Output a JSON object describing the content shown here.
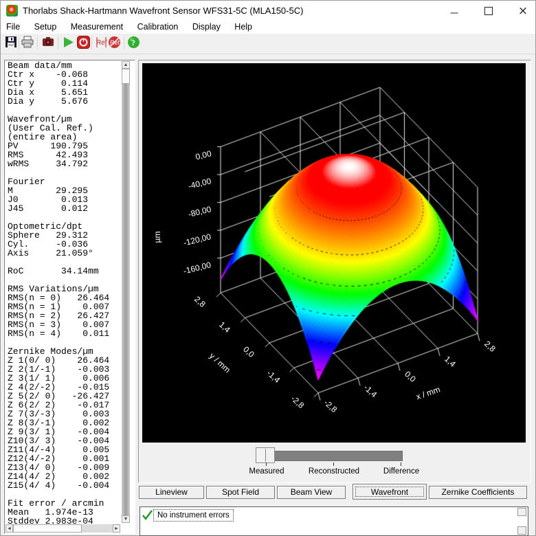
{
  "window": {
    "title": "Thorlabs Shack-Hartmann Wavefront Sensor WFS31-5C (MLA150-5C)",
    "controls": [
      "minimize",
      "maximize",
      "close"
    ]
  },
  "menu": {
    "items": [
      "File",
      "Setup",
      "Measurement",
      "Calibration",
      "Display",
      "Help"
    ]
  },
  "toolbar": {
    "icons": [
      "save",
      "print",
      "camera",
      "start",
      "stop",
      "reference-flat",
      "reference-user",
      "help"
    ]
  },
  "left_panel": {
    "lines": [
      "Beam data/mm",
      "Ctr x    -0.068",
      "Ctr y     0.114",
      "Dia x     5.651",
      "Dia y     5.676",
      "",
      "Wavefront/µm",
      "(User Cal. Ref.)",
      "(entire area)",
      "PV      190.795",
      "RMS      42.493",
      "wRMS     34.792",
      "",
      "Fourier",
      "M        29.295",
      "J0        0.013",
      "J45       0.012",
      "",
      "Optometric/dpt",
      "Sphere   29.312",
      "Cyl.     -0.036",
      "Axis     21.059°",
      "",
      "RoC       34.14mm",
      "",
      "RMS Variations/µm",
      "RMS(n = 0)   26.464",
      "RMS(n = 1)    0.007",
      "RMS(n = 2)   26.427",
      "RMS(n = 3)    0.007",
      "RMS(n = 4)    0.011",
      "",
      "Zernike Modes/µm",
      "Z 1(0/ 0)    26.464",
      "Z 2(1/-1)    -0.003",
      "Z 3(1/ 1)     0.006",
      "Z 4(2/-2)    -0.015",
      "Z 5(2/ 0)   -26.427",
      "Z 6(2/ 2)    -0.017",
      "Z 7(3/-3)     0.003",
      "Z 8(3/-1)     0.002",
      "Z 9(3/ 1)    -0.004",
      "Z10(3/ 3)    -0.004",
      "Z11(4/-4)     0.005",
      "Z12(4/-2)     0.001",
      "Z13(4/ 0)    -0.009",
      "Z14(4/ 2)     0.002",
      "Z15(4/ 4)    -0.004",
      "",
      "Fit error / arcmin",
      "Mean   1.974e-13",
      "Stddev 2.983e-04"
    ]
  },
  "slider": {
    "labels": [
      "Measured",
      "Reconstructed",
      "Difference"
    ],
    "value": "Measured"
  },
  "tabs": {
    "items": [
      "Lineview",
      "Spot Field",
      "Beam View",
      "Wavefront",
      "Zernike Coefficients"
    ],
    "active": "Wavefront"
  },
  "status": {
    "message": "No instrument errors",
    "state": "ok",
    "ok_color": "#1f9e1f"
  },
  "chart_data": {
    "type": "surface3d",
    "title": "Wavefront",
    "x": {
      "label": "x / mm",
      "range": [
        -2.8,
        2.8
      ],
      "ticks": [
        -2.8,
        -1.4,
        0,
        1.4,
        2.8
      ],
      "tick_labels": [
        "-2,8",
        "-1,4",
        "0,0",
        "1,4",
        "2,8"
      ]
    },
    "y": {
      "label": "y / mm",
      "range": [
        -2.8,
        2.8
      ],
      "ticks": [
        -2.8,
        -1.4,
        0,
        1.4,
        2.8
      ],
      "tick_labels": [
        "2,8",
        "1,4",
        "0,0",
        "-1,4",
        "-2,8"
      ]
    },
    "z": {
      "label": "µm",
      "range": [
        0,
        -209.87
      ],
      "ticks": [
        0,
        -40,
        -80,
        -120,
        -160
      ],
      "tick_labels": [
        "0,00",
        "-40,00",
        "-80,00",
        "-120,00",
        "-160,00"
      ]
    },
    "surface": {
      "model": "defocus_paraboloid",
      "equation": "z = -12.168*(x^2+y^2)",
      "coefficient": -12.168,
      "peak": 0,
      "pv": 190.795
    },
    "contours_um": [
      -30,
      -60,
      -90,
      -120,
      -150,
      -180
    ],
    "colormap": {
      "type": "hsv-rainbow",
      "hue_stops": [
        [
          0,
          0
        ],
        [
          0.09,
          0
        ],
        [
          0.355,
          60
        ],
        [
          0.52,
          120
        ],
        [
          0.64,
          180
        ],
        [
          0.8,
          240
        ],
        [
          1,
          300
        ]
      ],
      "white_cap_frac": 0.042
    },
    "background": "#000000",
    "grid_color": "#e8e8e8"
  }
}
